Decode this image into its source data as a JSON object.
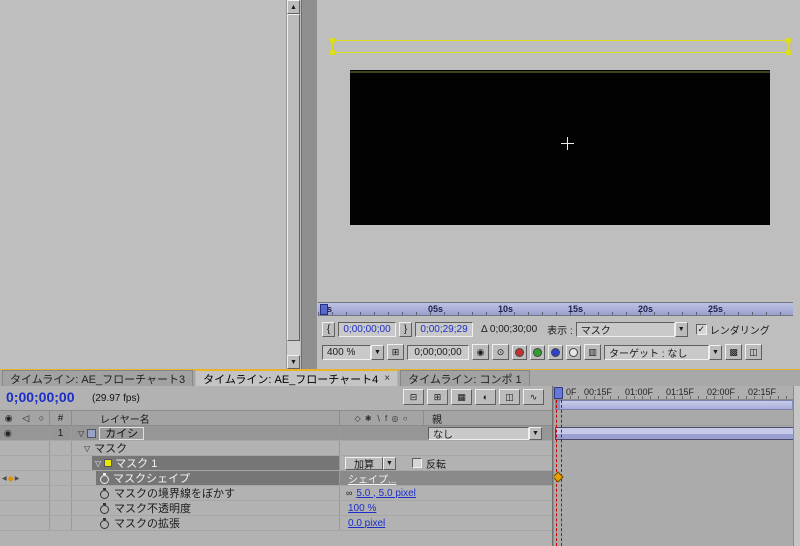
{
  "colors": {
    "mask_outline": "#DCDC20",
    "keyframe_orange": "#E8A000",
    "cti_red": "#C80000",
    "cti_marker_blue": "#6878D8",
    "layer_bar_lavender": "#9AA0D0",
    "value_blue": "#1B2EC8",
    "panel_highlight_yellow": "#E8B428",
    "red_channel": "#C23030",
    "green_channel": "#2E9E2E",
    "blue_channel": "#3040C8",
    "alpha_channel": "#E6E6E6"
  },
  "comp": {
    "ruler_labels": [
      "0s",
      "05s",
      "10s",
      "15s",
      "20s",
      "25s"
    ],
    "info": {
      "in_brace": "{",
      "in_time": "0;00;00;00",
      "out_brace": "}",
      "out_time": "0;00;29;29",
      "duration": "Δ 0;00;30;00",
      "view_label": "表示 :",
      "view_value": "マスク",
      "rendering_label": "レンダリング"
    },
    "tools": {
      "zoom": "400 %",
      "timecode": "0;00;00;00",
      "target": "ターゲット : なし"
    }
  },
  "tabs": {
    "tab1": "タイムライン: AE_フローチャート3",
    "tab2": "タイムライン: AE_フローチャート4",
    "tab2_close": "×",
    "tab3": "タイムライン: コンポ 1"
  },
  "timeline": {
    "timecode": "0;00;00;00",
    "fps": "(29.97 fps)",
    "header": {
      "hash": "#",
      "layer_name": "レイヤー名",
      "parent": "親",
      "switches": "◇ ✱ ∖ f ◎ ○"
    },
    "layer1": {
      "index": "1",
      "name": "カイシ",
      "parent_value": "なし"
    },
    "mask_group_label": "マスク",
    "mask1": {
      "label": "マスク 1",
      "mode": "加算",
      "invert": "反転"
    },
    "prop_shape": {
      "label": "マスクシェイプ",
      "value": "シェイプ..."
    },
    "prop_feather": {
      "label": "マスクの境界線をぼかす",
      "value": "5.0 , 5.0 pixel"
    },
    "prop_opacity": {
      "label": "マスク不透明度",
      "value": "100 %"
    },
    "prop_expansion": {
      "label": "マスクの拡張",
      "value": "0.0 pixel"
    },
    "ruler_labels": [
      "0F",
      "00:15F",
      "01:00F",
      "01:15F",
      "02:00F",
      "02:15F"
    ]
  },
  "icons": {
    "twirl": "▽",
    "eye": "◉",
    "audio": "◁",
    "lock": "○",
    "kf_prev": "◀",
    "kf_current": "◆",
    "kf_next": "▶",
    "arrow_down": "▼",
    "scroll_up": "▲",
    "scroll_down": "▼",
    "check": "✓",
    "link": "∞",
    "tc_buttons": [
      "⊟",
      "⊞",
      "▦",
      "◐",
      "◫",
      "∿"
    ],
    "tools": {
      "safe_margins": "⊞",
      "snapshot": "◉",
      "show_snapshot": "⊙",
      "resolution": "▥",
      "roi": "◻",
      "grid": "▩",
      "view": "◫"
    }
  }
}
